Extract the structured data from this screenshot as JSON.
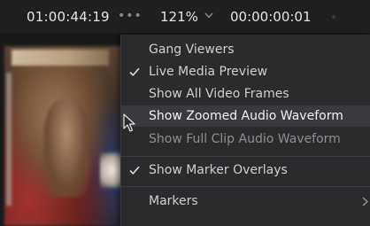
{
  "toolbar": {
    "timecode_left": "01:00:44:19",
    "more_icon": "ellipsis-icon",
    "zoom_value": "121%",
    "zoom_icon": "chevron-down-icon",
    "timecode_right": "00:00:00:01"
  },
  "menu": {
    "items": [
      {
        "label": "Gang Viewers",
        "checked": false,
        "enabled": true
      },
      {
        "label": "Live Media Preview",
        "checked": true,
        "enabled": true
      },
      {
        "label": "Show All Video Frames",
        "checked": false,
        "enabled": true
      },
      {
        "label": "Show Zoomed Audio Waveform",
        "checked": false,
        "enabled": true,
        "hovered": true
      },
      {
        "label": "Show Full Clip Audio Waveform",
        "checked": false,
        "enabled": false
      },
      {
        "label": "Show Marker Overlays",
        "checked": true,
        "enabled": true
      },
      {
        "label": "Markers",
        "checked": false,
        "enabled": true,
        "submenu": true
      }
    ]
  },
  "colors": {
    "toolbar_bg": "#1f1f22",
    "menu_bg": "#2b2b2e",
    "menu_hover": "#3a3a3e",
    "text": "#d6d6d6"
  }
}
